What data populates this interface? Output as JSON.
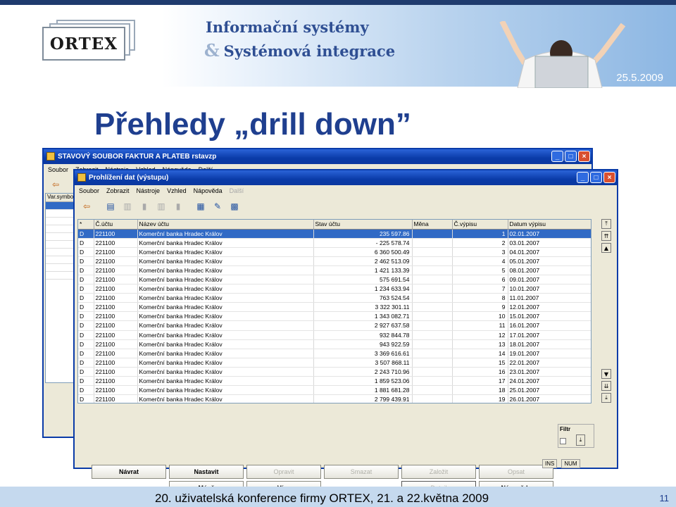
{
  "slide": {
    "date": "25.5.2009",
    "logo_text": "ORTEX",
    "tagline_line1": "Informační systémy",
    "tagline_amp": "&",
    "tagline_line2": "Systémová integrace",
    "title": "Přehledy „drill down”",
    "footer": "20. uživatelská konference firmy ORTEX, 21. a 22.května 2009",
    "page_number": "11"
  },
  "back_window": {
    "title": "STAVOVÝ SOUBOR FAKTUR A PLATEB    rstavzp",
    "menu": [
      "Soubor",
      "Zobrazit",
      "Nástroje",
      "Vzhled",
      "Nápověda",
      "Další"
    ],
    "column_header": "Var.symbo"
  },
  "front_window": {
    "title": "Prohlížení dat (výstupu)",
    "menu": [
      "Soubor",
      "Zobrazit",
      "Nástroje",
      "Vzhled",
      "Nápověda"
    ],
    "menu_disabled": "Další",
    "columns": [
      "*",
      "Č.účtu",
      "Název účtu",
      "Stav účtu",
      "Měna",
      "Č.výpisu",
      "Datum výpisu"
    ],
    "rows": [
      [
        "D",
        "221100",
        "Komerční banka Hradec Králov",
        "235 597.86",
        "",
        "1",
        "02.01.2007"
      ],
      [
        "D",
        "221100",
        "Komerční banka Hradec Králov",
        "- 225 578.74",
        "",
        "2",
        "03.01.2007"
      ],
      [
        "D",
        "221100",
        "Komerční banka Hradec Králov",
        "6 360 500.49",
        "",
        "3",
        "04.01.2007"
      ],
      [
        "D",
        "221100",
        "Komerční banka Hradec Králov",
        "2 462 513.09",
        "",
        "4",
        "05.01.2007"
      ],
      [
        "D",
        "221100",
        "Komerční banka Hradec Králov",
        "1 421 133.39",
        "",
        "5",
        "08.01.2007"
      ],
      [
        "D",
        "221100",
        "Komerční banka Hradec Králov",
        "575 691.54",
        "",
        "6",
        "09.01.2007"
      ],
      [
        "D",
        "221100",
        "Komerční banka Hradec Králov",
        "1 234 633.94",
        "",
        "7",
        "10.01.2007"
      ],
      [
        "D",
        "221100",
        "Komerční banka Hradec Králov",
        "763 524.54",
        "",
        "8",
        "11.01.2007"
      ],
      [
        "D",
        "221100",
        "Komerční banka Hradec Králov",
        "3 322 301.11",
        "",
        "9",
        "12.01.2007"
      ],
      [
        "D",
        "221100",
        "Komerční banka Hradec Králov",
        "1 343 082.71",
        "",
        "10",
        "15.01.2007"
      ],
      [
        "D",
        "221100",
        "Komerční banka Hradec Králov",
        "2 927 637.58",
        "",
        "11",
        "16.01.2007"
      ],
      [
        "D",
        "221100",
        "Komerční banka Hradec Králov",
        "932 844.78",
        "",
        "12",
        "17.01.2007"
      ],
      [
        "D",
        "221100",
        "Komerční banka Hradec Králov",
        "943 922.59",
        "",
        "13",
        "18.01.2007"
      ],
      [
        "D",
        "221100",
        "Komerční banka Hradec Králov",
        "3 369 616.61",
        "",
        "14",
        "19.01.2007"
      ],
      [
        "D",
        "221100",
        "Komerční banka Hradec Králov",
        "3 507 868.11",
        "",
        "15",
        "22.01.2007"
      ],
      [
        "D",
        "221100",
        "Komerční banka Hradec Králov",
        "2 243 710.96",
        "",
        "16",
        "23.01.2007"
      ],
      [
        "D",
        "221100",
        "Komerční banka Hradec Králov",
        "1 859 523.06",
        "",
        "17",
        "24.01.2007"
      ],
      [
        "D",
        "221100",
        "Komerční banka Hradec Králov",
        "1 881 681.28",
        "",
        "18",
        "25.01.2007"
      ],
      [
        "D",
        "221100",
        "Komerční banka Hradec Králov",
        "2 799 439.91",
        "",
        "19",
        "26.01.2007"
      ]
    ],
    "buttons": {
      "navrat": "Návrat",
      "nastavit": "Nastavit",
      "opravit": "Opravit",
      "smazat": "Smazat",
      "zalozit": "Založit",
      "opsat": "Opsat",
      "mene": "Méně",
      "vice": "Více",
      "detail": "Detail",
      "napoveda": "Nápověda"
    },
    "filter_label": "Filtr",
    "status": [
      "INS",
      "NUM"
    ]
  }
}
